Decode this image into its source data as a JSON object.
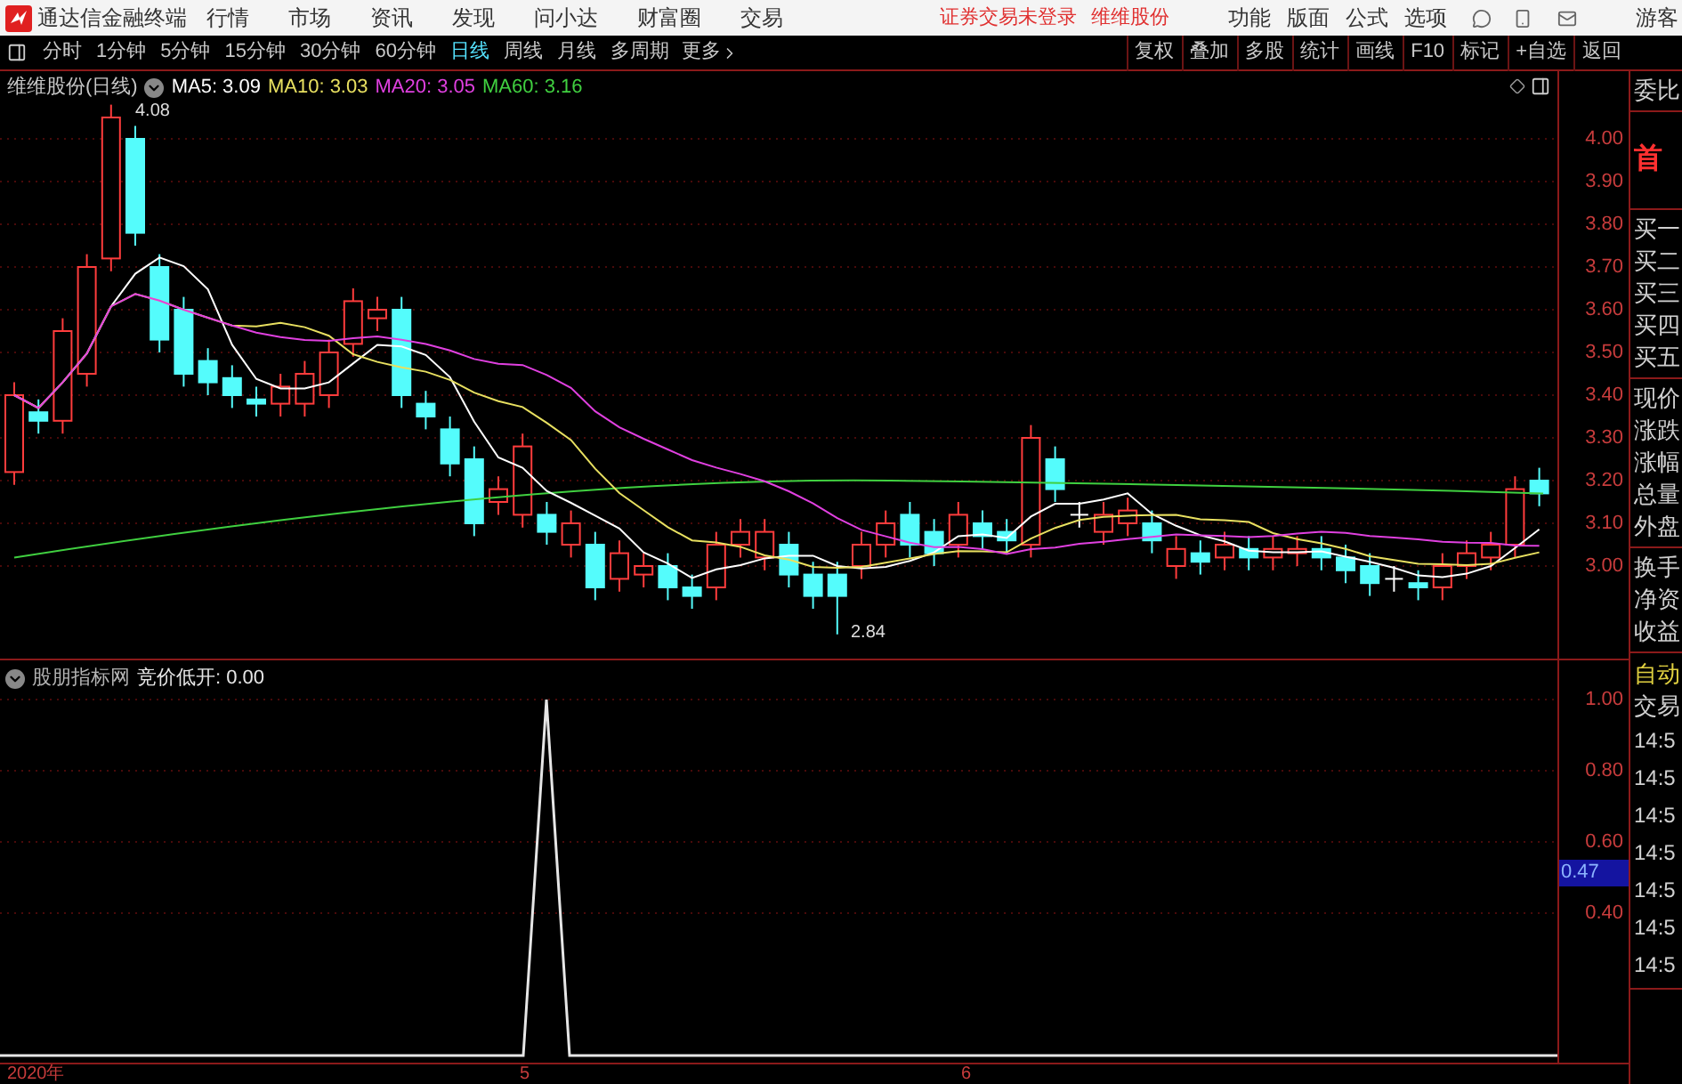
{
  "menubar": {
    "app_title": "通达信金融终端",
    "menus": [
      "行情",
      "市场",
      "资讯",
      "发现",
      "问小达",
      "财富圈",
      "交易"
    ],
    "notice": "证券交易未登录",
    "stock": "维维股份",
    "tools": [
      "功能",
      "版面",
      "公式",
      "选项"
    ],
    "user": "游客"
  },
  "periods": [
    {
      "label": "分时",
      "selected": false
    },
    {
      "label": "1分钟",
      "selected": false
    },
    {
      "label": "5分钟",
      "selected": false
    },
    {
      "label": "15分钟",
      "selected": false
    },
    {
      "label": "30分钟",
      "selected": false
    },
    {
      "label": "60分钟",
      "selected": false
    },
    {
      "label": "日线",
      "selected": true
    },
    {
      "label": "周线",
      "selected": false
    },
    {
      "label": "月线",
      "selected": false
    },
    {
      "label": "多周期",
      "selected": false
    }
  ],
  "more_label": "更多",
  "actions": [
    "复权",
    "叠加",
    "多股",
    "统计",
    "画线",
    "F10",
    "标记",
    "+自选",
    "返回"
  ],
  "chart": {
    "title": "维维股份(日线)",
    "ma": [
      {
        "label": "MA5: 3.09",
        "color": "#ffffff"
      },
      {
        "label": "MA10: 3.03",
        "color": "#e8e060"
      },
      {
        "label": "MA20: 3.05",
        "color": "#e040e0"
      },
      {
        "label": "MA60: 3.16",
        "color": "#40d040"
      }
    ],
    "high_label": "4.08",
    "low_label": "2.84",
    "price_ticks": [
      "4.00",
      "3.90",
      "3.80",
      "3.70",
      "3.60",
      "3.50",
      "3.40",
      "3.30",
      "3.20",
      "3.10",
      "3.00"
    ]
  },
  "indicator": {
    "source": "股朋指标网",
    "reading": "竞价低开: 0.00",
    "ticks": [
      "1.00",
      "0.80",
      "0.60",
      "0.40"
    ],
    "current": "0.47"
  },
  "dates": [
    "2020年",
    "5",
    "6"
  ],
  "quote_panel": [
    [
      {
        "text": "委比",
        "kind": "label"
      }
    ],
    [
      {
        "text": "首",
        "kind": "headline"
      }
    ],
    [
      {
        "text": "买一",
        "kind": "label"
      },
      {
        "text": "买二",
        "kind": "label"
      },
      {
        "text": "买三",
        "kind": "label"
      },
      {
        "text": "买四",
        "kind": "label"
      },
      {
        "text": "买五",
        "kind": "label"
      }
    ],
    [
      {
        "text": "现价",
        "kind": "label"
      },
      {
        "text": "涨跌",
        "kind": "label"
      },
      {
        "text": "涨幅",
        "kind": "label"
      },
      {
        "text": "总量",
        "kind": "label"
      },
      {
        "text": "外盘",
        "kind": "label"
      }
    ],
    [
      {
        "text": "换手",
        "kind": "label"
      },
      {
        "text": "净资",
        "kind": "label"
      },
      {
        "text": "收益",
        "kind": "label"
      }
    ],
    [
      {
        "text": "自动",
        "kind": "status"
      },
      {
        "text": "交易",
        "kind": "label"
      },
      {
        "text": "14:5",
        "kind": "time"
      },
      {
        "text": "14:5",
        "kind": "time"
      },
      {
        "text": "14:5",
        "kind": "time"
      },
      {
        "text": "14:5",
        "kind": "time"
      },
      {
        "text": "14:5",
        "kind": "time"
      },
      {
        "text": "14:5",
        "kind": "time"
      },
      {
        "text": "14:5",
        "kind": "time"
      }
    ]
  ]
}
